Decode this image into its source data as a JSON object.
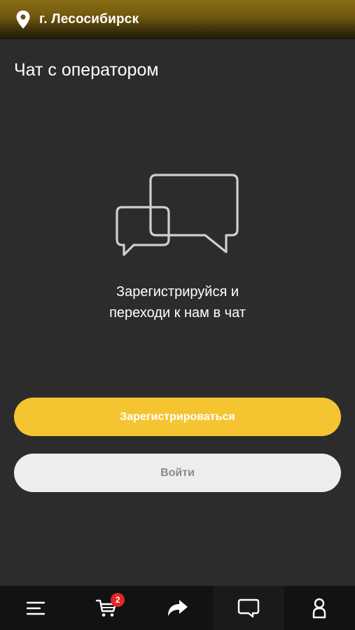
{
  "header": {
    "city": "г. Лесосибирск",
    "location_icon": "map-pin-icon"
  },
  "page": {
    "title": "Чат с оператором"
  },
  "illustration": {
    "icon": "chat-bubbles-icon"
  },
  "message": {
    "line1": "Зарегистрируйся и",
    "line2": "переходи к нам в чат"
  },
  "buttons": {
    "register_label": "Зарегистрироваться",
    "login_label": "Войти"
  },
  "bottom_nav": {
    "items": [
      {
        "icon": "menu-icon"
      },
      {
        "icon": "cart-icon",
        "badge": "2"
      },
      {
        "icon": "share-arrow-icon"
      },
      {
        "icon": "chat-icon"
      },
      {
        "icon": "profile-icon"
      }
    ]
  },
  "colors": {
    "accent": "#f5c531",
    "background": "#2c2c2c",
    "badge": "#e32626"
  }
}
